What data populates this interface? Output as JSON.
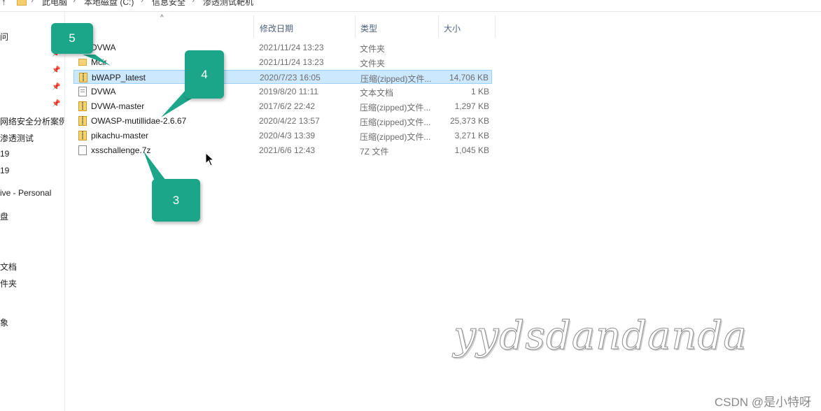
{
  "address_bar": {
    "crumbs": [
      "此电脑",
      "本地磁盘 (C:)",
      "信息安全",
      "渗透测试靶机"
    ]
  },
  "nav": {
    "items": [
      "问",
      "网络安全分析案例",
      "渗透测试",
      "19",
      "19",
      "ive - Personal",
      "盘",
      "文档",
      "件夹",
      "象"
    ]
  },
  "columns": {
    "date": "修改日期",
    "type": "类型",
    "size": "大小"
  },
  "files": [
    {
      "name": "DVWA",
      "date": "2021/11/24 13:23",
      "type": "文件夹",
      "size": "",
      "icon": "folder-icon",
      "selected": false
    },
    {
      "name": "Mcir",
      "date": "2021/11/24 13:23",
      "type": "文件夹",
      "size": "",
      "icon": "folder-icon",
      "selected": false
    },
    {
      "name": "bWAPP_latest",
      "date": "2020/7/23 16:05",
      "type": "压缩(zipped)文件...",
      "size": "14,706 KB",
      "icon": "zip-icon",
      "selected": true
    },
    {
      "name": "DVWA",
      "date": "2019/8/20 11:11",
      "type": "文本文档",
      "size": "1 KB",
      "icon": "text-document-icon",
      "selected": false
    },
    {
      "name": "DVWA-master",
      "date": "2017/6/2 22:42",
      "type": "压缩(zipped)文件...",
      "size": "1,297 KB",
      "icon": "zip-icon",
      "selected": false
    },
    {
      "name": "OWASP-mutillidae-2.6.67",
      "date": "2020/4/22 13:57",
      "type": "压缩(zipped)文件...",
      "size": "25,373 KB",
      "icon": "zip-icon",
      "selected": false
    },
    {
      "name": "pikachu-master",
      "date": "2020/4/3 13:39",
      "type": "压缩(zipped)文件...",
      "size": "3,271 KB",
      "icon": "zip-icon",
      "selected": false
    },
    {
      "name": "xsschallenge.7z",
      "date": "2021/6/6 12:43",
      "type": "7Z 文件",
      "size": "1,045 KB",
      "icon": "file-icon",
      "selected": false
    }
  ],
  "callouts": [
    "5",
    "4",
    "3"
  ],
  "watermark": "yydsdandanda",
  "credit": "CSDN @是小特呀",
  "colors": {
    "accent": "#1ba589",
    "selection": "#cce8ff",
    "selection_border": "#99d1ff",
    "header_text": "#4c607a"
  }
}
